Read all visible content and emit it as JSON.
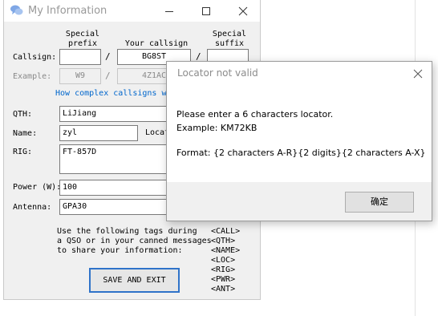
{
  "main_window": {
    "title": "My Information",
    "app_icon": "chat-bubbles-icon",
    "controls": [
      "minimize-icon",
      "maximize-icon",
      "close-icon"
    ]
  },
  "form": {
    "headers": {
      "prefix": "Special\nprefix",
      "callsign": "Your callsign",
      "suffix": "Special\nsuffix"
    },
    "callsign_label": "Callsign:",
    "prefix_value": "",
    "callsign_value": "BG8ST",
    "suffix_value": "",
    "slash": "/",
    "example_label": "Example:",
    "example_prefix": "W9",
    "example_callsign": "4Z1AC",
    "complex_link": "How complex callsigns w",
    "qth_label": "QTH:",
    "qth_value": "LiJiang",
    "name_label": "Name:",
    "name_value": "zyl",
    "locator_label": "Locat",
    "rig_label": "RIG:",
    "rig_value": "FT-857D",
    "power_label": "Power (W):",
    "power_value": "100",
    "antenna_label": "Antenna:",
    "antenna_value": "GPA30",
    "usage_text": [
      "Use the following tags during",
      "a QSO or in your canned messages",
      "to share your information:"
    ],
    "tags": [
      "<CALL>",
      "<QTH>",
      "<NAME>",
      "<LOC>",
      "<RIG>",
      "<PWR>",
      "<ANT>"
    ],
    "save_button": "SAVE AND EXIT"
  },
  "dialog": {
    "title": "Locator not valid",
    "line1": "Please enter a 6 characters locator.",
    "line2": "Example: KM72KB",
    "line3": "Format: {2 characters A-R}{2 digits}{2 characters A-X}",
    "ok_button": "确定"
  }
}
